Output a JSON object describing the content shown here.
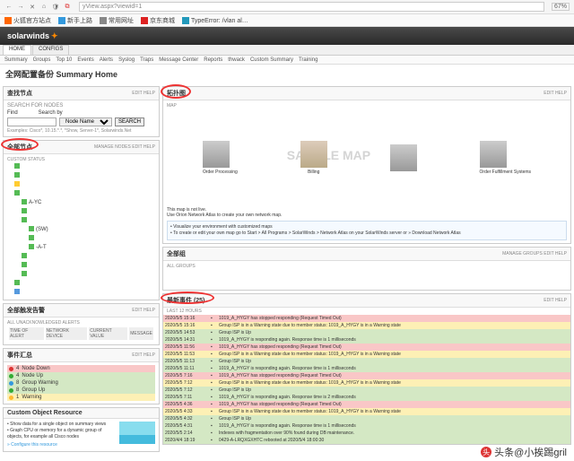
{
  "browser": {
    "url": "yView.aspx?viewid=1",
    "zoom": "67%",
    "bookmarks": [
      "火狐官方站点",
      "新手上路",
      "常用网址",
      "京东商城",
      "TypeError: /vlan al…"
    ]
  },
  "brand": "solarwinds",
  "main_tabs": [
    "HOME",
    "CONFIGS"
  ],
  "subnav": [
    "Summary",
    "Groups",
    "Top 10",
    "Events",
    "Alerts",
    "Syslog",
    "Traps",
    "Message Center",
    "Reports",
    "thwack",
    "Custom Summary",
    "Training"
  ],
  "page_title": "全网配置备份 Summary Home",
  "search_panel": {
    "title": "查找节点",
    "actions": "EDIT  HELP",
    "label": "SEARCH FOR NODES",
    "find": "Find",
    "searchby": "Search by",
    "option": "Node Name",
    "btn": "SEARCH",
    "example": "Examples: Cisco*, 10.15.*.*, *Show, Server-1*, Solarwinds.Net"
  },
  "nodes_panel": {
    "title": "全部节点",
    "actions": "MANAGE NODES  EDIT  HELP",
    "group": "CUSTOM STATUS",
    "items": [
      "",
      "",
      "",
      "",
      "A-YC",
      "",
      "",
      "(SW)",
      "",
      "-A-T",
      "",
      "",
      "",
      "",
      ""
    ]
  },
  "alerts_panel": {
    "title": "全部触发告警",
    "sub": "ALL UNACKNOWLEDGED ALERTS",
    "actions": "EDIT  HELP",
    "cols": [
      "TIME OF ALERT",
      "NETWORK DEVICE",
      "CURRENT VALUE",
      "MESSAGE"
    ]
  },
  "summary_panel": {
    "title": "事件汇总",
    "actions": "EDIT  HELP",
    "rows": [
      {
        "c": "dot-red",
        "n": "4",
        "t": "Node Down"
      },
      {
        "c": "dot-green",
        "n": "4",
        "t": "Node Up"
      },
      {
        "c": "dot-blue",
        "n": "8",
        "t": "Group Warning"
      },
      {
        "c": "dot-green",
        "n": "8",
        "t": "Group Up"
      },
      {
        "c": "dot-yellow",
        "n": "1",
        "t": "Warning"
      }
    ]
  },
  "custom_panel": {
    "title": "Custom Object Resource",
    "bullets": [
      "Show data for a single object on summary views",
      "Graph CPU or memory for a dynamic group of objects, for example all Cisco nodes"
    ],
    "link": "» Configure this resource"
  },
  "map_panel": {
    "title": "拓扑图",
    "sub": "MAP",
    "actions": "EDIT  HELP",
    "buildings": [
      "Billing",
      "Order Processing",
      "",
      "Order Fulfillment Systems"
    ],
    "sample": "SAMPLE MAP",
    "note1": "This map is not live.",
    "note2": "Use Orion Network Atlas to create your own network map.",
    "info": [
      "Visualize your environment with customized maps",
      "To create or edit your own map go to Start > All Programs > SolarWinds > Network Atlas on your SolarWinds server or » Download Network Atlas"
    ]
  },
  "groups_panel": {
    "title": "全部组",
    "sub": "ALL GROUPS",
    "actions": "MANAGE GROUPS  EDIT  HELP"
  },
  "events_panel": {
    "title": "最新事件  (25)",
    "sub": "LAST 12 HOURS",
    "actions": "EDIT  HELP",
    "rows": [
      {
        "t": "2020/5/5 15:16",
        "c": "ev-red",
        "m": "1019_A_HYGY has stopped responding (Request Timed Out)"
      },
      {
        "t": "2020/5/5 15:16",
        "c": "ev-yellow",
        "m": "Group ISP is in a Warning state due to member status: 1019_A_HYGY is in a Warning state"
      },
      {
        "t": "2020/5/5 14:53",
        "c": "ev-green",
        "m": "Group ISP is Up"
      },
      {
        "t": "2020/5/5 14:31",
        "c": "ev-green",
        "m": "1019_A_HYGY is responding again. Response time is 1 milliseconds"
      },
      {
        "t": "2020/5/5 11:56",
        "c": "ev-red",
        "m": "1019_A_HYGY has stopped responding (Request Timed Out)"
      },
      {
        "t": "2020/5/5 11:53",
        "c": "ev-yellow",
        "m": "Group ISP is in a Warning state due to member status: 1019_A_HYGY is in a Warning state"
      },
      {
        "t": "2020/5/5 11:13",
        "c": "ev-green",
        "m": "Group ISP is Up"
      },
      {
        "t": "2020/5/5 11:11",
        "c": "ev-green",
        "m": "1019_A_HYGY is responding again. Response time is 1 milliseconds"
      },
      {
        "t": "2020/5/5 7:16",
        "c": "ev-red",
        "m": "1019_A_HYGY has stopped responding (Request Timed Out)"
      },
      {
        "t": "2020/5/5 7:12",
        "c": "ev-yellow",
        "m": "Group ISP is in a Warning state due to member status: 1019_A_HYGY is in a Warning state"
      },
      {
        "t": "2020/5/5 7:12",
        "c": "ev-green",
        "m": "Group ISP is Up"
      },
      {
        "t": "2020/5/5 7:11",
        "c": "ev-green",
        "m": "1019_A_HYGY is responding again. Response time is 2 milliseconds"
      },
      {
        "t": "2020/5/5 4:36",
        "c": "ev-red",
        "m": "1019_A_HYGY has stopped responding (Request Timed Out)"
      },
      {
        "t": "2020/5/5 4:33",
        "c": "ev-yellow",
        "m": "Group ISP is in a Warning state due to member status: 1019_A_HYGY is in a Warning state"
      },
      {
        "t": "2020/5/5 4:32",
        "c": "ev-green",
        "m": "Group ISP is Up"
      },
      {
        "t": "2020/5/5 4:31",
        "c": "ev-green",
        "m": "1019_A_HYGY is responding again. Response time is 1 milliseconds"
      },
      {
        "t": "2020/5/5 2:14",
        "c": "ev-green",
        "m": "Indexes with fragmentation over 90% found during DB maintenance."
      },
      {
        "t": "2020/4/4 18:19",
        "c": "ev-green",
        "m": "0429-A-LRQXGXHTC rebooted at 2020/5/4 18:00:30"
      }
    ]
  },
  "watermark": "头条@小挨踢gril"
}
